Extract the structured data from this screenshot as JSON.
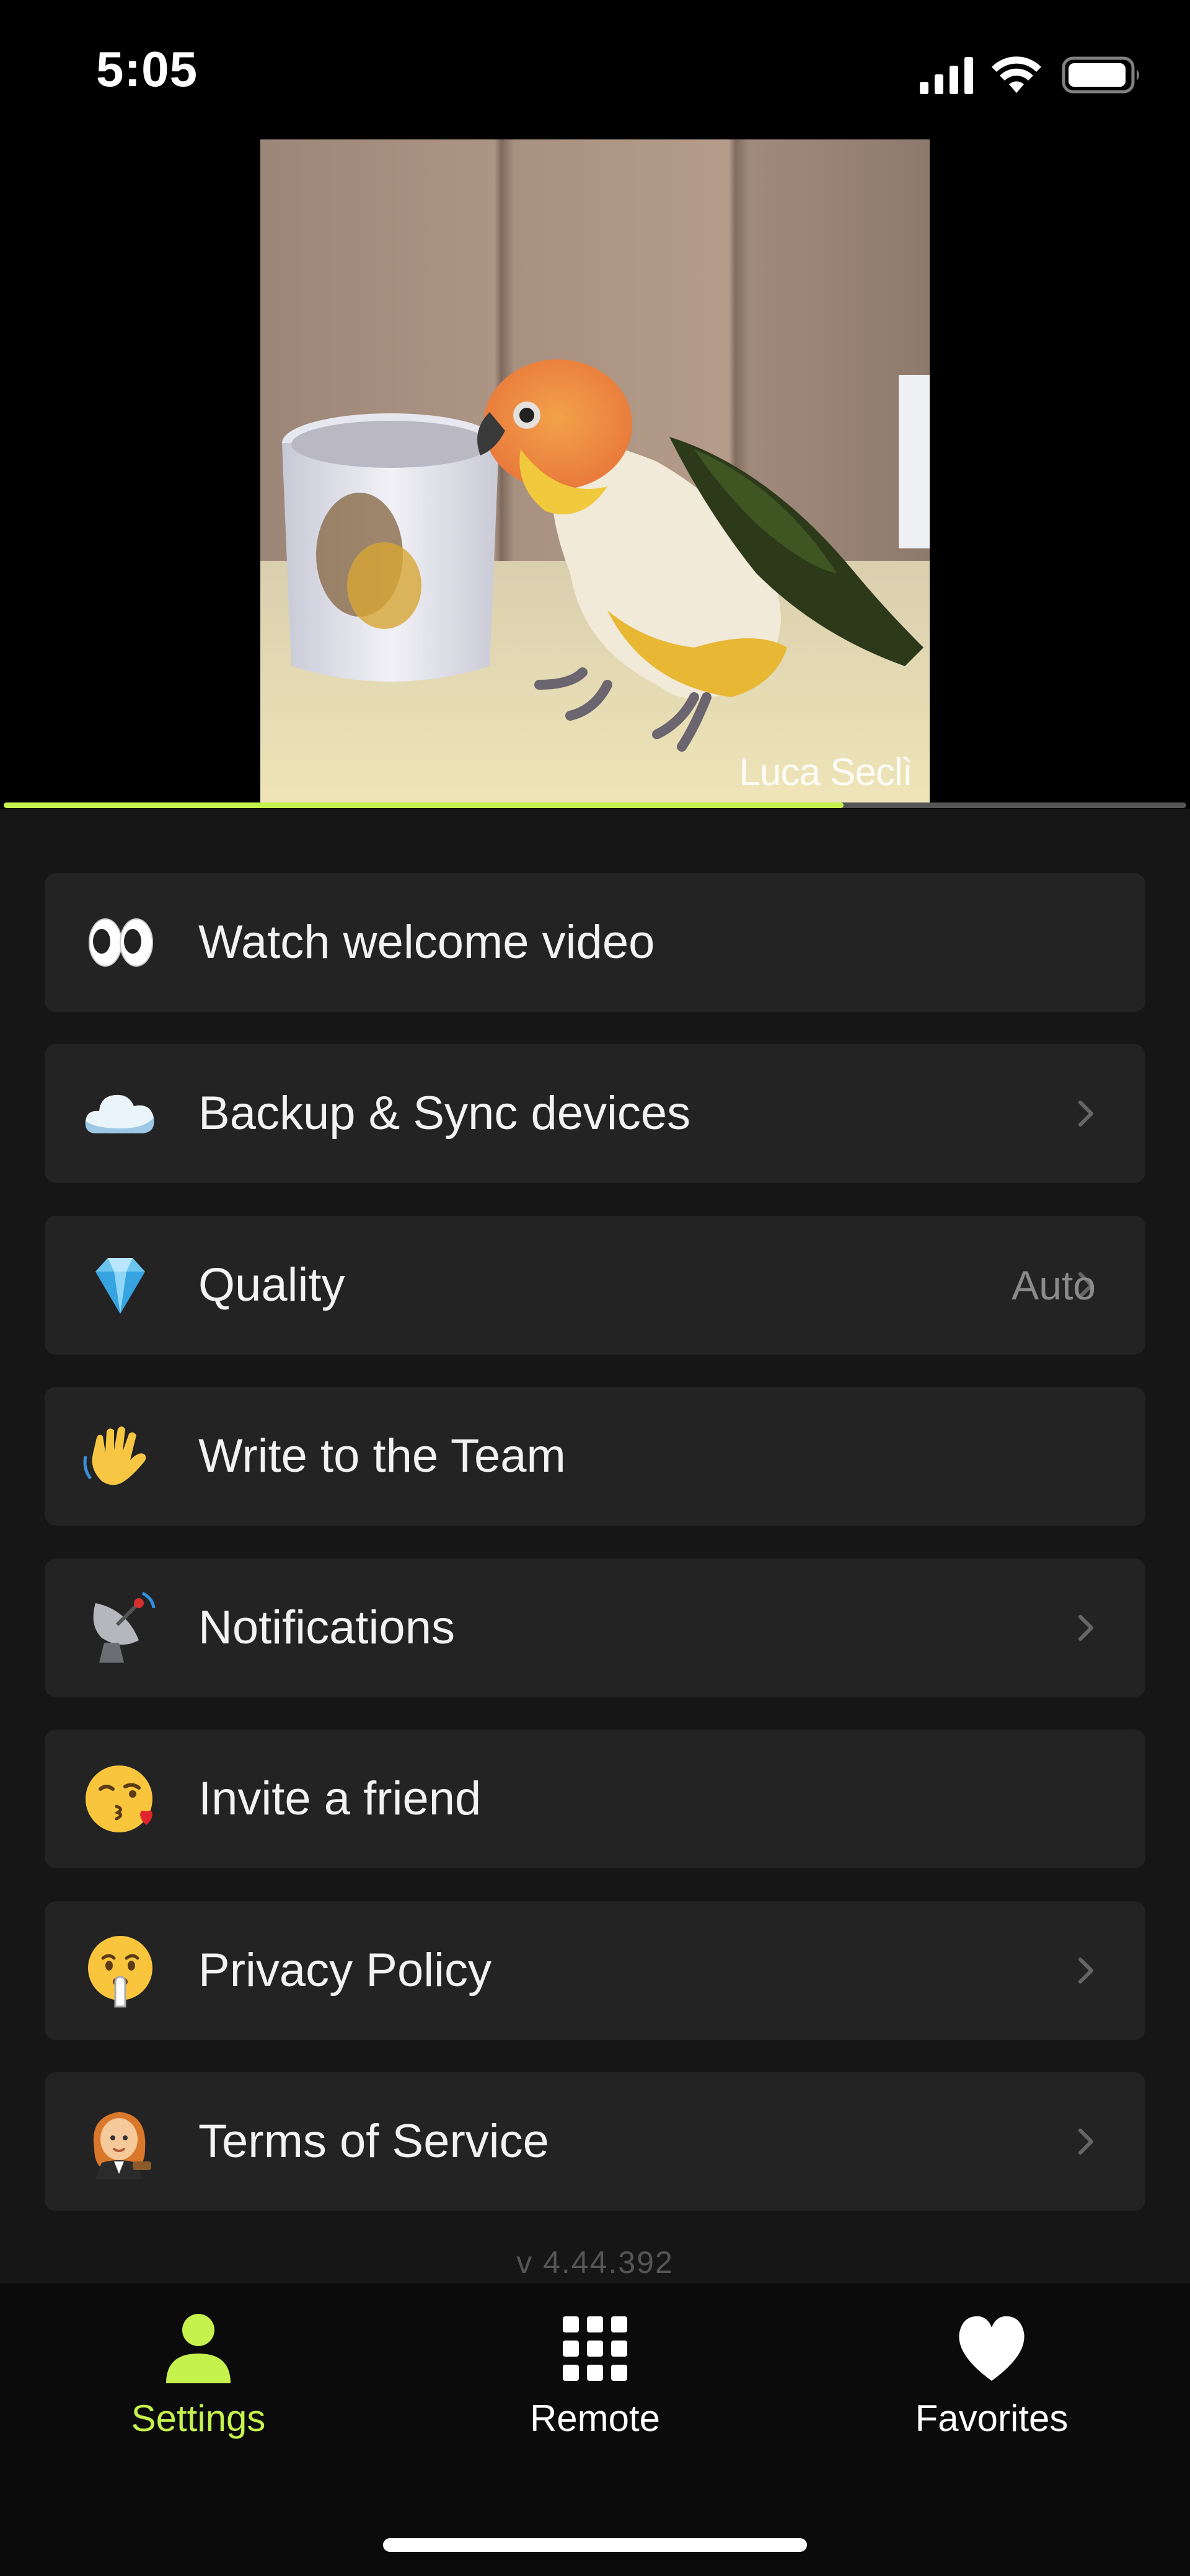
{
  "status_bar": {
    "time": "5:05",
    "icons": [
      "cellular-signal-icon",
      "wifi-icon",
      "battery-icon"
    ]
  },
  "video": {
    "credit": "Luca Seclì",
    "progress": 0.71
  },
  "menu": {
    "items": [
      {
        "icon": "eyes-emoji-icon",
        "label": "Watch welcome video",
        "chevron": false,
        "value": ""
      },
      {
        "icon": "cloud-emoji-icon",
        "label": "Backup & Sync devices",
        "chevron": true,
        "value": ""
      },
      {
        "icon": "gem-emoji-icon",
        "label": "Quality",
        "chevron": true,
        "value": "Auto"
      },
      {
        "icon": "waving-hand-emoji-icon",
        "label": "Write to the Team",
        "chevron": false,
        "value": ""
      },
      {
        "icon": "satellite-antenna-emoji-icon",
        "label": "Notifications",
        "chevron": true,
        "value": ""
      },
      {
        "icon": "face-blowing-kiss-emoji-icon",
        "label": "Invite a friend",
        "chevron": false,
        "value": ""
      },
      {
        "icon": "shushing-face-emoji-icon",
        "label": "Privacy Policy",
        "chevron": true,
        "value": ""
      },
      {
        "icon": "judge-emoji-icon",
        "label": "Terms of Service",
        "chevron": true,
        "value": ""
      }
    ]
  },
  "version": "v 4.44.392",
  "tab_bar": {
    "tabs": [
      {
        "label": "Settings",
        "icon": "person-icon",
        "active": true
      },
      {
        "label": "Remote",
        "icon": "grid-icon",
        "active": false
      },
      {
        "label": "Favorites",
        "icon": "heart-icon",
        "active": false
      }
    ]
  },
  "colors": {
    "accent": "#c6f24e",
    "background": "#161616",
    "card": "#232323",
    "tab_bar": "#0b0b0b"
  }
}
